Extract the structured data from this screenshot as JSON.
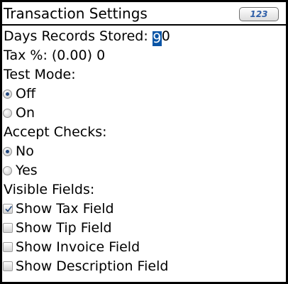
{
  "screen": {
    "title": "Transaction Settings",
    "input_mode_badge": "123"
  },
  "fields": {
    "days_records_label": "Days Records Stored:",
    "days_records_value_highlighted": "9",
    "days_records_value_rest": "0",
    "tax_label": "Tax %: (0.00)",
    "tax_value": "0"
  },
  "test_mode": {
    "label": "Test Mode:",
    "options": [
      {
        "label": "Off",
        "selected": true
      },
      {
        "label": "On",
        "selected": false
      }
    ]
  },
  "accept_checks": {
    "label": "Accept Checks:",
    "options": [
      {
        "label": "No",
        "selected": true
      },
      {
        "label": "Yes",
        "selected": false
      }
    ]
  },
  "visible_fields": {
    "label": "Visible Fields:",
    "options": [
      {
        "label": "Show Tax Field",
        "checked": true
      },
      {
        "label": "Show Tip Field",
        "checked": false
      },
      {
        "label": "Show Invoice Field",
        "checked": false
      },
      {
        "label": "Show Description Field",
        "checked": false
      }
    ]
  },
  "colors": {
    "highlight": "#0a55a6",
    "radio_dot": "#24497f",
    "badge_text": "#2f5fa8",
    "border": "#000000"
  },
  "icons": {
    "input_mode": "numeric-input-mode-icon",
    "radio_selected": "radio-selected-icon",
    "radio_unselected": "radio-unselected-icon",
    "checkbox_checked": "checkbox-checked-icon",
    "checkbox_unchecked": "checkbox-unchecked-icon"
  }
}
